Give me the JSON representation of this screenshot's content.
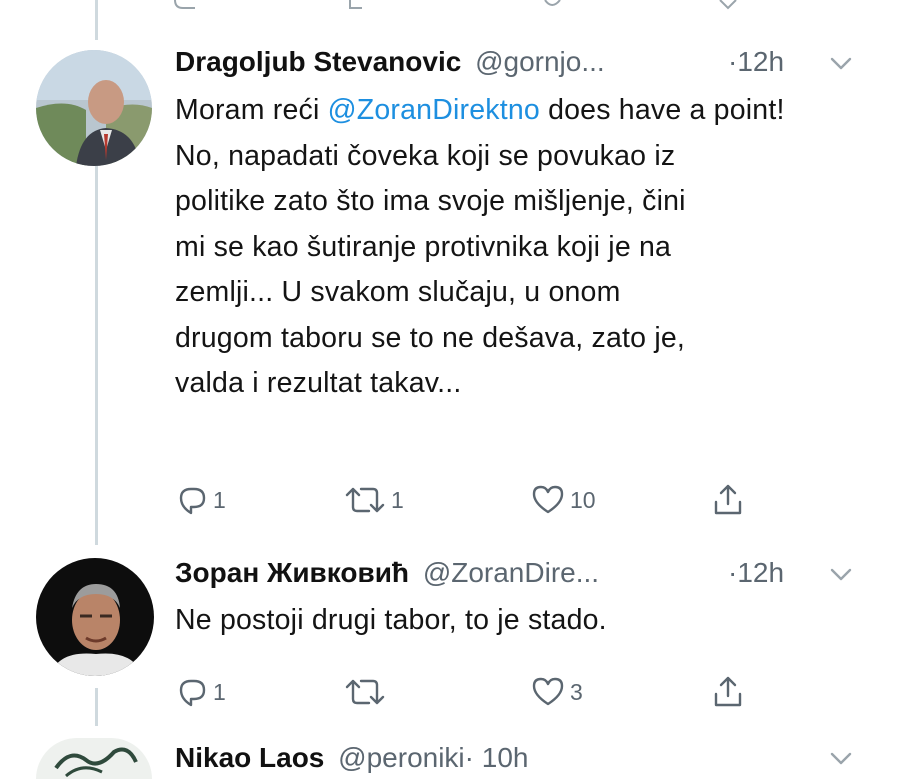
{
  "colors": {
    "link": "#1d8fe0",
    "muted": "#5b6670",
    "thread_line": "#cfd9de"
  },
  "tweets": [
    {
      "name": "Dragoljub Stevanovic",
      "handle": "@gornjo...",
      "time": "·12h",
      "body_prefix": "Moram reći ",
      "mention": "@ZoranDirektno",
      "body_rest": " does have a point!",
      "body_lines": [
        "No, napadati čoveka koji se povukao iz",
        "politike zato što ima svoje mišljenje, čini",
        "mi se kao šutiranje protivnika koji je na",
        "zemlji... U svakom slučaju, u onom",
        "drugom taboru se to ne dešava, zato je,",
        "valda i rezultat takav..."
      ],
      "reply_count": "1",
      "retweet_count": "1",
      "like_count": "10",
      "avatar_icon": "user-photo-avatar"
    },
    {
      "name": "Зоран Живковић",
      "handle": "@ZoranDire...",
      "time": "·12h",
      "body": "Ne postoji drugi tabor, to je stado.",
      "reply_count": "1",
      "retweet_count": "",
      "like_count": "3",
      "avatar_icon": "user-photo-avatar"
    },
    {
      "name": "Nikao Laos",
      "handle": "@peroniki",
      "time": "· 10h",
      "avatar_icon": "user-photo-avatar"
    }
  ]
}
